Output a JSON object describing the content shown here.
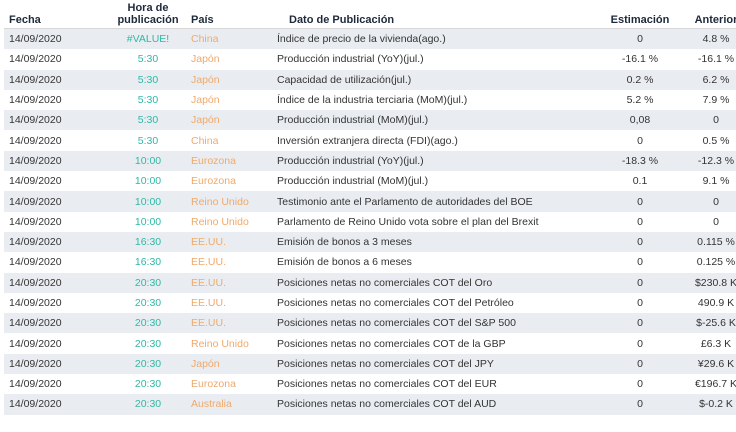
{
  "headers": {
    "fecha": "Fecha",
    "hora": "Hora de publicación",
    "pais": "País",
    "dato": "Dato de Publicación",
    "estimacion": "Estimación",
    "anterior": "Anterior"
  },
  "colors": {
    "hora": "#2db9a6",
    "pais": "#f0a96a",
    "stripe": "#e9edf1"
  },
  "rows": [
    {
      "fecha": "14/09/2020",
      "hora": "#VALUE!",
      "pais": "China",
      "dato": "Índice de precio de la vivienda(ago.)",
      "estimacion": "0",
      "anterior": "4.8 %"
    },
    {
      "fecha": "14/09/2020",
      "hora": "5:30",
      "pais": "Japón",
      "dato": "Producción industrial (YoY)(jul.)",
      "estimacion": "-16.1 %",
      "anterior": "-16.1 %"
    },
    {
      "fecha": "14/09/2020",
      "hora": "5:30",
      "pais": "Japón",
      "dato": "Capacidad de utilización(jul.)",
      "estimacion": "0.2 %",
      "anterior": "6.2 %"
    },
    {
      "fecha": "14/09/2020",
      "hora": "5:30",
      "pais": "Japón",
      "dato": "Índice de la industria terciaria (MoM)(jul.)",
      "estimacion": "5.2 %",
      "anterior": "7.9 %"
    },
    {
      "fecha": "14/09/2020",
      "hora": "5:30",
      "pais": "Japón",
      "dato": "Producción industrial (MoM)(jul.)",
      "estimacion": "0,08",
      "anterior": "0"
    },
    {
      "fecha": "14/09/2020",
      "hora": "5:30",
      "pais": "China",
      "dato": "Inversión extranjera directa (FDI)(ago.)",
      "estimacion": "0",
      "anterior": "0.5 %"
    },
    {
      "fecha": "14/09/2020",
      "hora": "10:00",
      "pais": "Eurozona",
      "dato": "Producción industrial (YoY)(jul.)",
      "estimacion": "-18.3 %",
      "anterior": "-12.3 %"
    },
    {
      "fecha": "14/09/2020",
      "hora": "10:00",
      "pais": "Eurozona",
      "dato": "Producción industrial (MoM)(jul.)",
      "estimacion": "0.1",
      "anterior": "9.1 %"
    },
    {
      "fecha": "14/09/2020",
      "hora": "10:00",
      "pais": "Reino Unido",
      "dato": "Testimonio ante el Parlamento de autoridades del BOE",
      "estimacion": "0",
      "anterior": "0"
    },
    {
      "fecha": "14/09/2020",
      "hora": "10:00",
      "pais": "Reino Unido",
      "dato": "Parlamento de Reino Unido vota sobre el plan del Brexit",
      "estimacion": "0",
      "anterior": "0"
    },
    {
      "fecha": "14/09/2020",
      "hora": "16:30",
      "pais": "EE.UU.",
      "dato": "Emisión de bonos a 3 meses",
      "estimacion": "0",
      "anterior": "0.115 %"
    },
    {
      "fecha": "14/09/2020",
      "hora": "16:30",
      "pais": "EE.UU.",
      "dato": "Emisión de bonos a 6 meses",
      "estimacion": "0",
      "anterior": "0.125 %"
    },
    {
      "fecha": "14/09/2020",
      "hora": "20:30",
      "pais": "EE.UU.",
      "dato": "Posiciones netas no comerciales COT del Oro",
      "estimacion": "0",
      "anterior": "$230.8 K"
    },
    {
      "fecha": "14/09/2020",
      "hora": "20:30",
      "pais": "EE.UU.",
      "dato": "Posiciones netas no comerciales COT del Petróleo",
      "estimacion": "0",
      "anterior": "490.9 K"
    },
    {
      "fecha": "14/09/2020",
      "hora": "20:30",
      "pais": "EE.UU.",
      "dato": "Posiciones netas no comerciales COT del S&P 500",
      "estimacion": "0",
      "anterior": "$-25.6 K"
    },
    {
      "fecha": "14/09/2020",
      "hora": "20:30",
      "pais": "Reino Unido",
      "dato": "Posiciones netas no comerciales COT de la GBP",
      "estimacion": "0",
      "anterior": "£6.3 K"
    },
    {
      "fecha": "14/09/2020",
      "hora": "20:30",
      "pais": "Japón",
      "dato": "Posiciones netas no comerciales COT del JPY",
      "estimacion": "0",
      "anterior": "¥29.6 K"
    },
    {
      "fecha": "14/09/2020",
      "hora": "20:30",
      "pais": "Eurozona",
      "dato": "Posiciones netas no comerciales COT del EUR",
      "estimacion": "0",
      "anterior": "€196.7 K"
    },
    {
      "fecha": "14/09/2020",
      "hora": "20:30",
      "pais": "Australia",
      "dato": "Posiciones netas no comerciales COT del AUD",
      "estimacion": "0",
      "anterior": "$-0.2 K"
    }
  ]
}
